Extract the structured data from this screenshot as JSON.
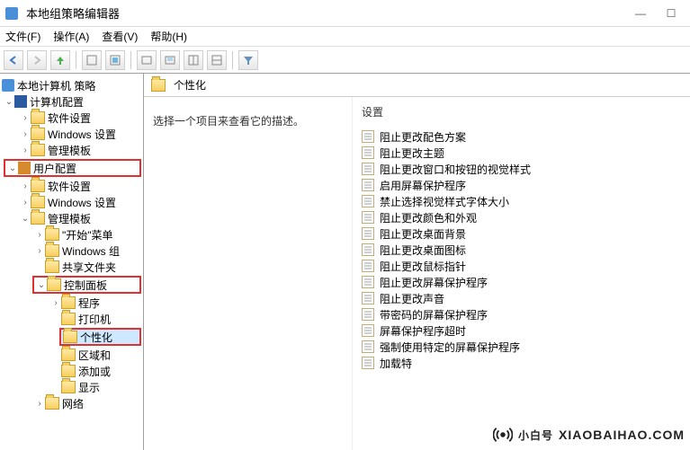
{
  "window": {
    "title": "本地组策略编辑器"
  },
  "menu": {
    "file": "文件(F)",
    "action": "操作(A)",
    "view": "查看(V)",
    "help": "帮助(H)"
  },
  "toolbar": {
    "back": "←",
    "forward": "→",
    "up": "↑",
    "sep": "|",
    "icons": [
      "a",
      "b",
      "c",
      "d",
      "e",
      "f",
      "g",
      "h"
    ]
  },
  "tree": {
    "root": "本地计算机 策略",
    "computer_cfg": "计算机配置",
    "comp_children": {
      "software": "软件设置",
      "windows": "Windows 设置",
      "admin_tpl": "管理模板"
    },
    "user_cfg": "用户配置",
    "user_children": {
      "software": "软件设置",
      "windows": "Windows 设置",
      "admin_tpl": "管理模板",
      "start_menu": "\"开始\"菜单",
      "windows_comp": "Windows 组",
      "shared_files": "共享文件夹",
      "control_panel": "控制面板",
      "programs": "程序",
      "printers": "打印机",
      "personalization": "个性化",
      "regions": "区域和",
      "add": "添加或",
      "display": "显示"
    },
    "network": "网络"
  },
  "content": {
    "header_title": "个性化",
    "desc_prompt": "选择一个项目来查看它的描述。",
    "settings_label": "设置",
    "settings": [
      "阻止更改配色方案",
      "阻止更改主题",
      "阻止更改窗口和按钮的视觉样式",
      "启用屏幕保护程序",
      "禁止选择视觉样式字体大小",
      "阻止更改颜色和外观",
      "阻止更改桌面背景",
      "阻止更改桌面图标",
      "阻止更改鼠标指针",
      "阻止更改屏幕保护程序",
      "阻止更改声音",
      "带密码的屏幕保护程序",
      "屏幕保护程序超时",
      "强制使用特定的屏幕保护程序",
      "加载特"
    ]
  },
  "watermark": {
    "brand": "小白号",
    "domain": "XIAOBAIHAO.COM"
  }
}
